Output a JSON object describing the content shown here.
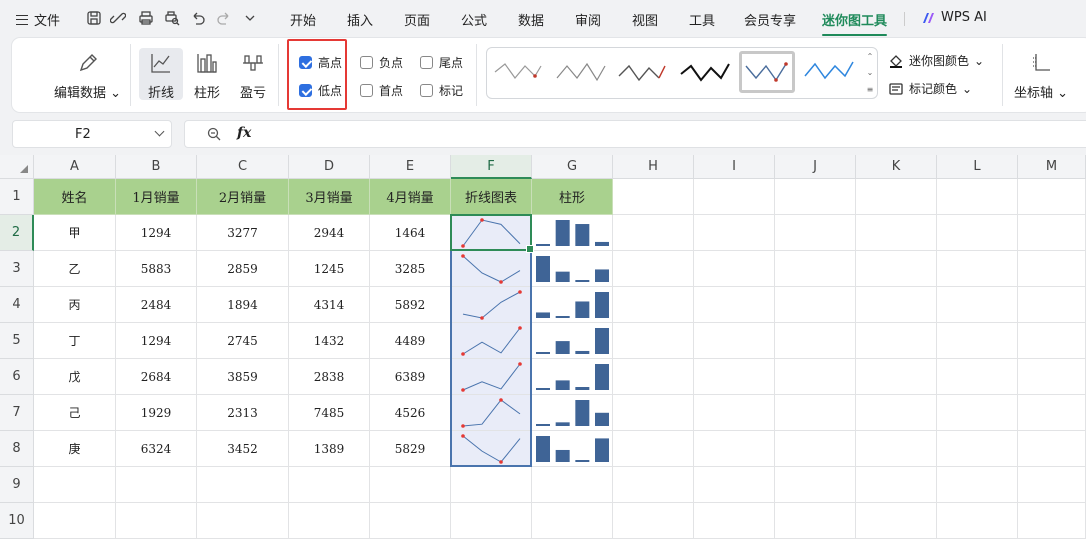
{
  "menubar": {
    "file_label": "文件",
    "tabs": [
      {
        "label": "开始",
        "active": false
      },
      {
        "label": "插入",
        "active": false
      },
      {
        "label": "页面",
        "active": false
      },
      {
        "label": "公式",
        "active": false
      },
      {
        "label": "数据",
        "active": false
      },
      {
        "label": "审阅",
        "active": false
      },
      {
        "label": "视图",
        "active": false
      },
      {
        "label": "工具",
        "active": false
      },
      {
        "label": "会员专享",
        "active": false
      },
      {
        "label": "迷你图工具",
        "active": true
      }
    ],
    "ai_label": "WPS AI",
    "quick_access_icons": [
      "save-icon",
      "share-icon",
      "print-icon",
      "print-preview-icon",
      "undo-icon",
      "redo-icon",
      "more-dropdown-icon"
    ]
  },
  "ribbon": {
    "edit_data_label": "编辑数据",
    "type_buttons": [
      {
        "label": "折线",
        "selected": true
      },
      {
        "label": "柱形",
        "selected": false
      },
      {
        "label": "盈亏",
        "selected": false
      }
    ],
    "show_options": [
      {
        "label": "高点",
        "checked": true
      },
      {
        "label": "低点",
        "checked": true
      },
      {
        "label": "负点",
        "checked": false
      },
      {
        "label": "首点",
        "checked": false
      },
      {
        "label": "尾点",
        "checked": false
      },
      {
        "label": "标记",
        "checked": false
      }
    ],
    "sparkline_color_label": "迷你图颜色",
    "marker_color_label": "标记颜色",
    "axis_label": "坐标轴",
    "highlight_color": "#e53935",
    "accent_color": "#1f8a5a"
  },
  "formula_bar": {
    "name_box": "F2",
    "fx_label": "fx",
    "formula": ""
  },
  "sheet": {
    "columns": [
      "A",
      "B",
      "C",
      "D",
      "E",
      "F",
      "G",
      "H",
      "I",
      "J",
      "K",
      "L",
      "M"
    ],
    "rows": [
      "1",
      "2",
      "3",
      "4",
      "5",
      "6",
      "7",
      "8",
      "9",
      "10"
    ],
    "headers": [
      "姓名",
      "1月销量",
      "2月销量",
      "3月销量",
      "4月销量",
      "折线图表",
      "柱形"
    ],
    "data": [
      {
        "name": "甲",
        "values": [
          1294,
          3277,
          2944,
          1464
        ]
      },
      {
        "name": "乙",
        "values": [
          5883,
          2859,
          1245,
          3285
        ]
      },
      {
        "name": "丙",
        "values": [
          2484,
          1894,
          4314,
          5892
        ]
      },
      {
        "name": "丁",
        "values": [
          1294,
          2745,
          1432,
          4489
        ]
      },
      {
        "name": "戊",
        "values": [
          2684,
          3859,
          2838,
          6389
        ]
      },
      {
        "name": "己",
        "values": [
          1929,
          2313,
          7485,
          4526
        ]
      },
      {
        "name": "庚",
        "values": [
          6324,
          3452,
          1389,
          5829
        ]
      }
    ],
    "header_fill": "#a9d18e",
    "sparkline_line_color": "#4a74ad",
    "sparkline_marker_color": "#e53935",
    "column_bar_color": "#3f6496"
  }
}
